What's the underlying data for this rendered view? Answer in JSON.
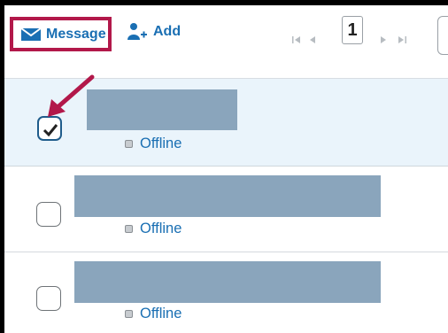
{
  "toolbar": {
    "message_label": "Message",
    "add_label": "Add"
  },
  "pager": {
    "current_page": "1"
  },
  "rows": [
    {
      "checked": true,
      "status": "Offline"
    },
    {
      "checked": false,
      "status": "Offline"
    },
    {
      "checked": false,
      "status": "Offline"
    }
  ],
  "colors": {
    "accent": "#1a6fb3",
    "highlight": "#b2184a",
    "selected_row": "#eaf4fb",
    "name_redaction": "#8aa5bc"
  },
  "icons": {
    "message": "envelope-icon",
    "add": "add-user-icon",
    "pager_first": "first-page-icon",
    "pager_prev": "previous-page-icon",
    "pager_next": "next-page-icon",
    "pager_last": "last-page-icon",
    "status": "presence-dot-icon",
    "checkbox": "checkmark-icon",
    "annotation": "arrow-icon"
  }
}
